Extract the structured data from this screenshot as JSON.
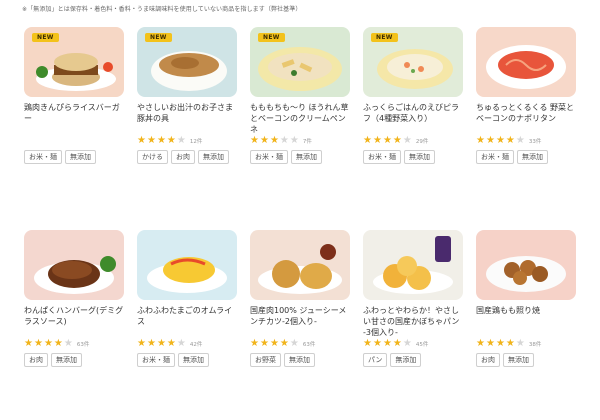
{
  "note": "※「無添加」とは保存料・着色料・香料・うま味調味料を使用していない商品を指します（弊社基準）",
  "colors": {
    "star": "#f1b41b",
    "new_badge": "#f3c21b"
  },
  "products": [
    {
      "title": "鶏肉きんぴらライスバーガー",
      "new": true,
      "new_label": "NEW",
      "rating": null,
      "count": "",
      "tags": [
        "お米・麺",
        "無添加"
      ]
    },
    {
      "title": "やさしいお出汁のお子さま豚丼の具",
      "new": true,
      "new_label": "NEW",
      "rating": 4,
      "count": "12件",
      "tags": [
        "かける",
        "お肉",
        "無添加"
      ]
    },
    {
      "title": "もももちも〜り ほうれん草とベーコンのクリームペンネ",
      "new": true,
      "new_label": "NEW",
      "rating": 3.5,
      "count": "7件",
      "tags": [
        "お米・麺",
        "無添加"
      ]
    },
    {
      "title": "ふっくらごはんのえびピラフ（4種野菜入り）",
      "new": true,
      "new_label": "NEW",
      "rating": 4.5,
      "count": "29件",
      "tags": [
        "お米・麺",
        "無添加"
      ]
    },
    {
      "title": "ちゅるっとくるくる 野菜とベーコンのナポリタン",
      "new": false,
      "new_label": "",
      "rating": 4.5,
      "count": "33件",
      "tags": [
        "お米・麺",
        "無添加"
      ]
    },
    {
      "title": "わんぱくハンバーグ(デミグラスソース)",
      "new": false,
      "new_label": "",
      "rating": 4.5,
      "count": "63件",
      "tags": [
        "お肉",
        "無添加"
      ]
    },
    {
      "title": "ふわふわたまごのオムライス",
      "new": false,
      "new_label": "",
      "rating": 4,
      "count": "42件",
      "tags": [
        "お米・麺",
        "無添加"
      ]
    },
    {
      "title": "国産肉100% ジューシーメンチカツ-2個入り-",
      "new": false,
      "new_label": "",
      "rating": 4.5,
      "count": "63件",
      "tags": [
        "お野菜",
        "無添加"
      ]
    },
    {
      "title": "ふわっとやわらか！やさしい甘さの国産かぼちゃパン -3個入り-",
      "new": false,
      "new_label": "",
      "rating": 4.5,
      "count": "45件",
      "tags": [
        "パン",
        "無添加"
      ]
    },
    {
      "title": "国産鶏もも照り焼",
      "new": false,
      "new_label": "",
      "rating": 4.5,
      "count": "38件",
      "tags": [
        "お肉",
        "無添加"
      ]
    }
  ]
}
